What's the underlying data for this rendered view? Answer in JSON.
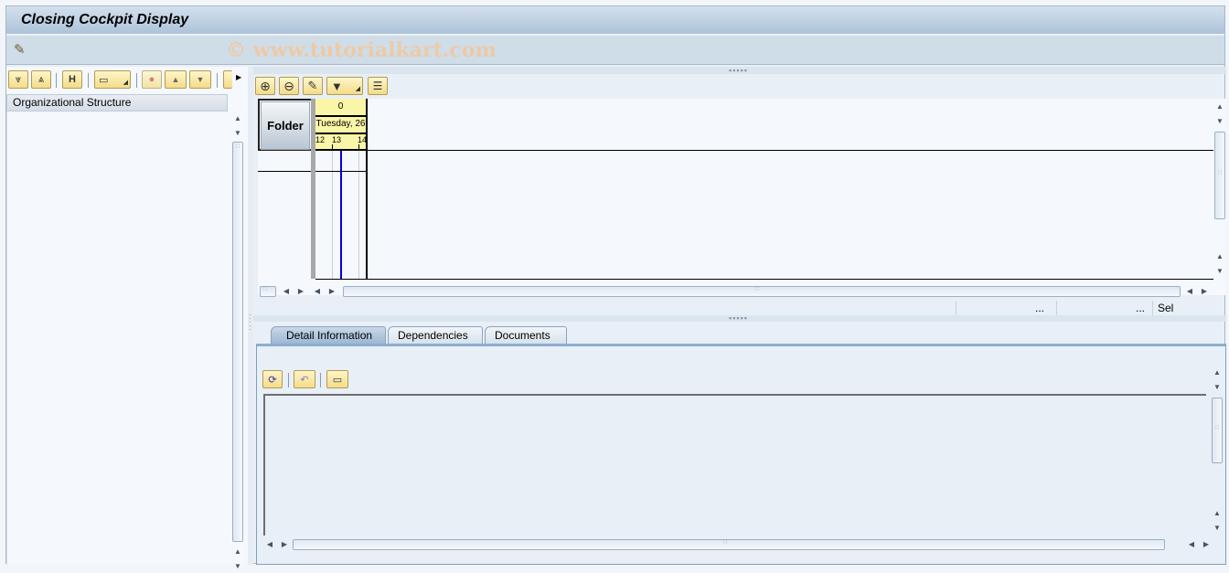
{
  "window": {
    "title": "Closing Cockpit Display",
    "watermark": "© www.tutorialkart.com"
  },
  "app_toolbar": {
    "items": [
      {
        "name": "display-change-toggle",
        "icon": "pencil-glasses-icon"
      }
    ]
  },
  "left_panel": {
    "toolbar": [
      {
        "name": "expand-all",
        "icon": "expand-icon",
        "glyph": "⩔"
      },
      {
        "name": "collapse-all",
        "icon": "collapse-icon",
        "glyph": "⩓"
      },
      {
        "name": "find",
        "icon": "binoculars-icon",
        "glyph": "🔭"
      },
      {
        "name": "print",
        "icon": "printer-icon",
        "glyph": "▭"
      },
      {
        "name": "hat",
        "icon": "hat-icon",
        "glyph": "🎩"
      },
      {
        "name": "move-up",
        "icon": "arrow-up-icon",
        "glyph": "▲"
      },
      {
        "name": "move-down",
        "icon": "arrow-down-icon",
        "glyph": "▼"
      }
    ],
    "column_header": "Organizational Structure"
  },
  "gantt": {
    "toolbar": [
      {
        "name": "zoom-in",
        "icon": "zoom-in-icon",
        "glyph": "⊕"
      },
      {
        "name": "zoom-out",
        "icon": "zoom-out-icon",
        "glyph": "⊖"
      },
      {
        "name": "edit-chart",
        "icon": "chart-edit-icon",
        "glyph": "✎"
      },
      {
        "name": "filter",
        "icon": "filter-icon",
        "glyph": "⏷"
      },
      {
        "name": "legend",
        "icon": "list-icon",
        "glyph": "☰"
      }
    ],
    "folder_label": "Folder",
    "time_header": {
      "top": "0",
      "day": "Tuesday, 26",
      "hours": [
        "12",
        "13",
        "14"
      ]
    },
    "status": {
      "field1": "...",
      "field2": "...",
      "field3": "Sel"
    }
  },
  "detail": {
    "tabs": [
      {
        "label": "Detail Information",
        "active": true
      },
      {
        "label": "Dependencies",
        "active": false
      },
      {
        "label": "Documents",
        "active": false
      }
    ],
    "toolbar": [
      {
        "name": "refresh",
        "icon": "refresh-icon",
        "glyph": "⟳"
      },
      {
        "name": "undo",
        "icon": "undo-icon",
        "glyph": "↶"
      },
      {
        "name": "print",
        "icon": "printer-icon",
        "glyph": "▭"
      }
    ],
    "text": ""
  }
}
